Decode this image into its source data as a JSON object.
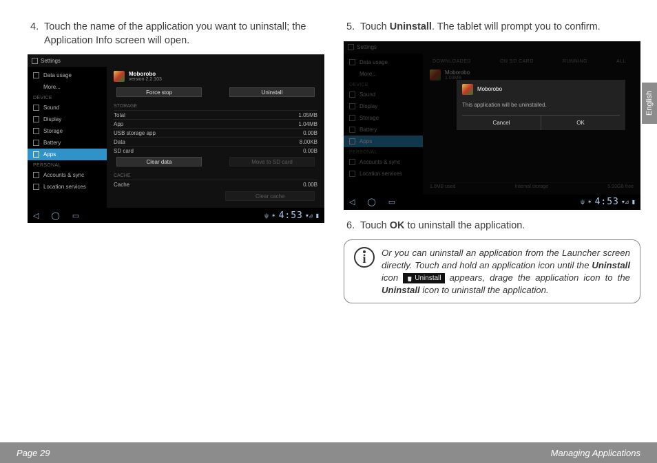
{
  "lang_tab": "English",
  "footer": {
    "page": "Page 29",
    "section": "Managing Applications"
  },
  "steps": {
    "s4": {
      "num": "4.",
      "text_a": "Touch the name of the application you want to uninstall; the Application Info screen will open."
    },
    "s5": {
      "num": "5.",
      "text_a": "Touch ",
      "bold": "Uninstall",
      "text_b": ". The tablet will prompt you to confirm."
    },
    "s6": {
      "num": "6.",
      "text_a": "Touch ",
      "bold": "OK",
      "text_b": " to uninstall the application."
    }
  },
  "info": {
    "t1": "Or you can uninstall an application from the Launcher screen directly. Touch and hold an application icon until the ",
    "b1": "Uninstall",
    "t2": " icon ",
    "badge": "Uninstall",
    "t3": " appears, drage the application icon to the ",
    "b2": "Uninstall",
    "t4": " icon to uninstall the application."
  },
  "shot": {
    "title": "Settings",
    "clock": "4:53",
    "side_sec1": "DEVICE",
    "side_sec2": "PERSONAL",
    "side": {
      "data_usage": "Data usage",
      "more": "More...",
      "sound": "Sound",
      "display": "Display",
      "storage": "Storage",
      "battery": "Battery",
      "apps": "Apps",
      "accounts": "Accounts & sync",
      "location": "Location services"
    },
    "app": {
      "name": "Moborobo",
      "version": "version 2.2.103",
      "size": "1.03MB"
    },
    "buttons": {
      "force_stop": "Force stop",
      "uninstall": "Uninstall",
      "clear_data": "Clear data",
      "move_sd": "Move to SD card",
      "clear_cache": "Clear cache"
    },
    "storage_lbl": "STORAGE",
    "cache_lbl": "CACHE",
    "storage": {
      "total_k": "Total",
      "total_v": "1.05MB",
      "app_k": "App",
      "app_v": "1.04MB",
      "usb_k": "USB storage app",
      "usb_v": "0.00B",
      "data_k": "Data",
      "data_v": "8.00KB",
      "sd_k": "SD card",
      "sd_v": "0.00B",
      "cache_k": "Cache",
      "cache_v": "0.00B"
    },
    "tabs": {
      "downloaded": "DOWNLOADED",
      "sd": "ON SD CARD",
      "running": "RUNNING",
      "all": "ALL"
    },
    "dialog": {
      "msg": "This application will be uninstalled.",
      "cancel": "Cancel",
      "ok": "OK"
    },
    "btm": {
      "used": "1.0MB used",
      "label": "Internal storage",
      "free": "5.93GB free"
    }
  }
}
